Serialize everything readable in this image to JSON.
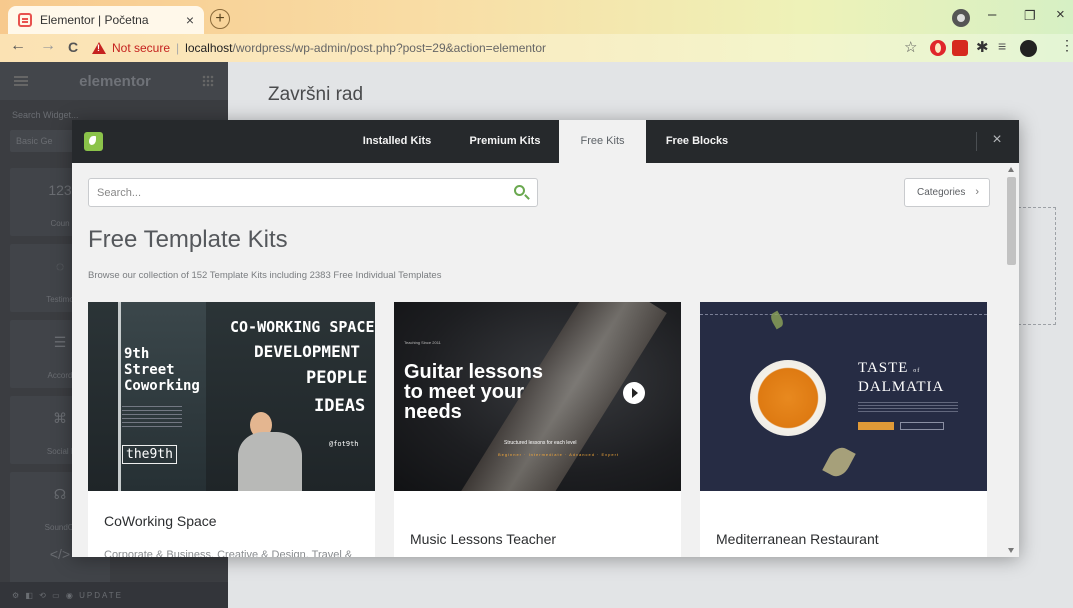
{
  "browser": {
    "tab_title": "Elementor | Početna",
    "tab_close": "×",
    "new_tab": "+",
    "back": "←",
    "forward": "→",
    "reload": "C",
    "security_label": "Not secure",
    "url_host": "localhost",
    "url_path": "/wordpress/wp-admin/post.php?post=29&action=elementor",
    "star": "☆",
    "minimize": "–",
    "maximize": "❐",
    "close": "×"
  },
  "editor": {
    "logo": "elementor",
    "search_placeholder": "Search Widget...",
    "tab_basic": "Basic Ge",
    "widgets": [
      {
        "label": "Coun",
        "icon": "123"
      },
      {
        "label": "Testimo",
        "icon": "◌"
      },
      {
        "label": "Accord",
        "icon": "☰"
      },
      {
        "label": "Social I",
        "icon": "⌘"
      },
      {
        "label": "SoundCl",
        "icon": "☊"
      },
      {
        "label": "",
        "icon": "</>"
      }
    ],
    "footer_update": "UPDATE",
    "page_title": "Završni rad"
  },
  "modal": {
    "tabs": [
      {
        "label": "Installed Kits",
        "active": false
      },
      {
        "label": "Premium Kits",
        "active": false
      },
      {
        "label": "Free Kits",
        "active": true
      },
      {
        "label": "Free Blocks",
        "active": false
      }
    ],
    "close": "×",
    "search_placeholder": "Search...",
    "categories_label": "Categories",
    "categories_chevron": "›",
    "title": "Free Template Kits",
    "subtitle": "Browse our collection of 152 Template Kits including 2383 Free Individual Templates",
    "cards": [
      {
        "name": "CoWorking Space",
        "tags": "Corporate & Business, Creative & Design, Travel &",
        "image": {
          "brand": "9th Street Coworking",
          "headline_1": "CO-WORKING SPACE",
          "headline_2": "DEVELOPMENT",
          "headline_3": "PEOPLE",
          "headline_4": "IDEAS",
          "handle": "@fot9th",
          "logo": "the9th"
        }
      },
      {
        "name": "Music Lessons Teacher",
        "tags": "",
        "image": {
          "since": "Teaching Since 2011",
          "headline_1": "Guitar lessons",
          "headline_2": "to meet your",
          "headline_3": "needs",
          "structured": "Structured lessons for each level",
          "levels": "Beginner · Intermediate · Advanced · Expert"
        }
      },
      {
        "name": "Mediterranean Restaurant",
        "tags": "",
        "image": {
          "title_1": "TASTE",
          "title_of": "of",
          "title_2": "DALMATIA"
        }
      }
    ]
  }
}
